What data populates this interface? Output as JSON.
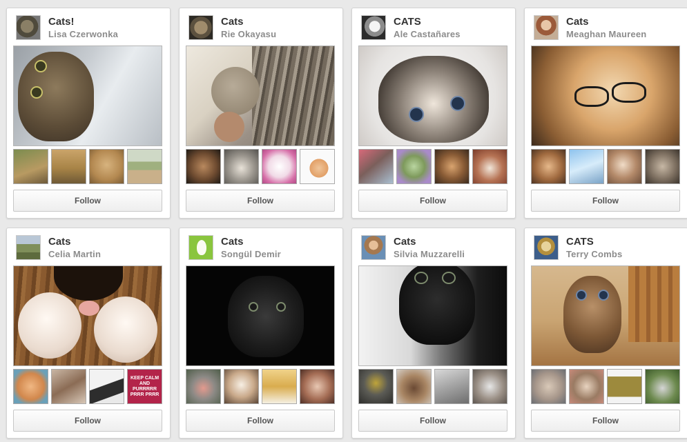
{
  "boards": [
    {
      "title": "Cats!",
      "owner": "Lisa Czerwonka",
      "follow_label": "Follow"
    },
    {
      "title": "Cats",
      "owner": "Rie Okayasu",
      "follow_label": "Follow"
    },
    {
      "title": "CATS",
      "owner": "Ale Castañares",
      "follow_label": "Follow"
    },
    {
      "title": "Cats",
      "owner": "Meaghan Maureen",
      "follow_label": "Follow"
    },
    {
      "title": "Cats",
      "owner": "Celia Martin",
      "follow_label": "Follow"
    },
    {
      "title": "Cats",
      "owner": "Songül Demir",
      "follow_label": "Follow"
    },
    {
      "title": "Cats",
      "owner": "Silvia Muzzarelli",
      "follow_label": "Follow"
    },
    {
      "title": "CATS",
      "owner": "Terry Combs",
      "follow_label": "Follow"
    }
  ],
  "thumb_text": {
    "keep_calm": "KEEP CALM AND PURRRRR PRRR PRRR"
  }
}
